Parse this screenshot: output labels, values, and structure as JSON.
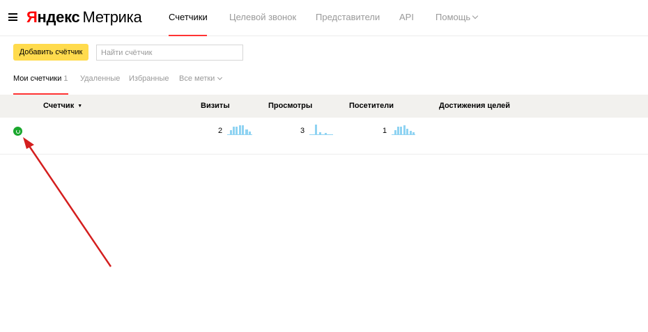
{
  "header": {
    "logo_ya": "Я",
    "logo_rest": "ндекс",
    "logo_product": "Метрика",
    "menu_icon": "hamburger-menu-icon",
    "nav": [
      {
        "label": "Счетчики",
        "active": true
      },
      {
        "label": "Целевой звонок",
        "active": false
      },
      {
        "label": "Представители",
        "active": false
      },
      {
        "label": "API",
        "active": false
      },
      {
        "label": "Помощь",
        "active": false,
        "has_dropdown": true
      }
    ]
  },
  "toolbar": {
    "add_button_label": "Добавить счётчик",
    "search_placeholder": "Найти счётчик",
    "search_value": ""
  },
  "subtabs": [
    {
      "label": "Мои счетчики",
      "count": "1",
      "active": true
    },
    {
      "label": "Удаленные",
      "active": false
    },
    {
      "label": "Избранные",
      "active": false
    },
    {
      "label": "Все метки",
      "active": false,
      "has_dropdown": true
    }
  ],
  "table": {
    "columns": {
      "counter": "Счетчик",
      "visits": "Визиты",
      "views": "Просмотры",
      "visitors": "Посетители",
      "goals": "Достижения целей"
    },
    "sort_indicator": "▼",
    "rows": [
      {
        "status": "active",
        "visits": "2",
        "views": "3",
        "visitors": "1",
        "goals": ""
      }
    ]
  },
  "colors": {
    "accent_red": "#ff3333",
    "button_yellow": "#ffdb4d",
    "status_green": "#1aa72d",
    "sparkline_blue": "#8fd3f2",
    "annotation_arrow": "#d41e1e"
  }
}
